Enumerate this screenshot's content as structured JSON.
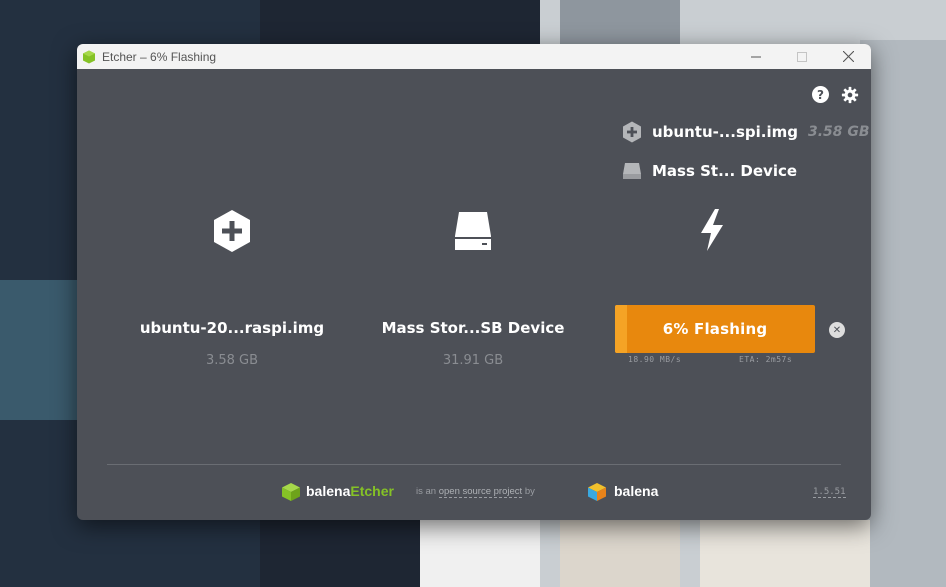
{
  "window": {
    "title": "Etcher – 6% Flashing"
  },
  "top_icons": {
    "help": "?",
    "settings": "gear"
  },
  "summary": {
    "image_name": "ubuntu-...spi.img",
    "image_size": "3.58 GB",
    "drive_name": "Mass St... Device"
  },
  "steps": {
    "image": {
      "name": "ubuntu-20...raspi.img",
      "size": "3.58 GB"
    },
    "drive": {
      "name": "Mass Stor...SB Device",
      "size": "31.91 GB"
    }
  },
  "flash": {
    "progress_label": "6% Flashing",
    "progress_percent": 6,
    "speed": "18.90 MB/s",
    "eta": "ETA: 2m57s"
  },
  "footer": {
    "brand_prefix": "balena",
    "brand_suffix": "Etcher",
    "is_an": "is an",
    "open_source_project": "open source project",
    "by": "by",
    "company": "balena",
    "version": "1.5.51"
  },
  "colors": {
    "window_bg": "#4d5057",
    "progress": "#e8880d",
    "progress_fill": "#f5a325",
    "brand_accent": "#85c226"
  },
  "icons": [
    "etcher-app-icon",
    "help-icon",
    "gear-icon",
    "image-hex-icon",
    "drive-icon",
    "bolt-icon",
    "cancel-icon",
    "balena-cube-icon"
  ]
}
